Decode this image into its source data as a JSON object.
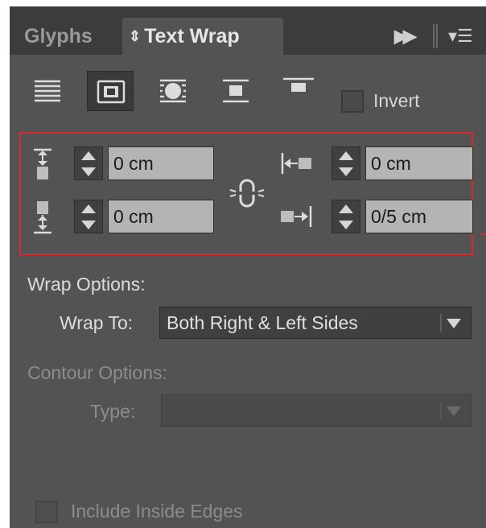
{
  "tabs": {
    "glyphs": "Glyphs",
    "text_wrap": "Text Wrap",
    "text_wrap_icon": "⇕"
  },
  "wrap_buttons": [
    {
      "name": "no-text-wrap",
      "selected": false
    },
    {
      "name": "wrap-around-bounding-box",
      "selected": true
    },
    {
      "name": "wrap-around-object-shape",
      "selected": false
    },
    {
      "name": "jump-object",
      "selected": false
    },
    {
      "name": "jump-to-next-column",
      "selected": false
    }
  ],
  "invert": {
    "label": "Invert",
    "checked": false
  },
  "offsets": {
    "top": "0 cm",
    "bottom": "0 cm",
    "left": "0 cm",
    "right": "0/5 cm"
  },
  "wrap_options": {
    "section_title": "Wrap Options:",
    "wrap_to_label": "Wrap To:",
    "wrap_to_value": "Both Right & Left Sides"
  },
  "contour_options": {
    "section_title": "Contour Options:",
    "type_label": "Type:",
    "type_value": ""
  },
  "include_inside_edges": {
    "label": "Include Inside Edges",
    "checked": false
  },
  "colors": {
    "highlight_box": "#d72a2a",
    "panel_bg": "#535353",
    "tab_bar_bg": "#3c3c3c"
  }
}
